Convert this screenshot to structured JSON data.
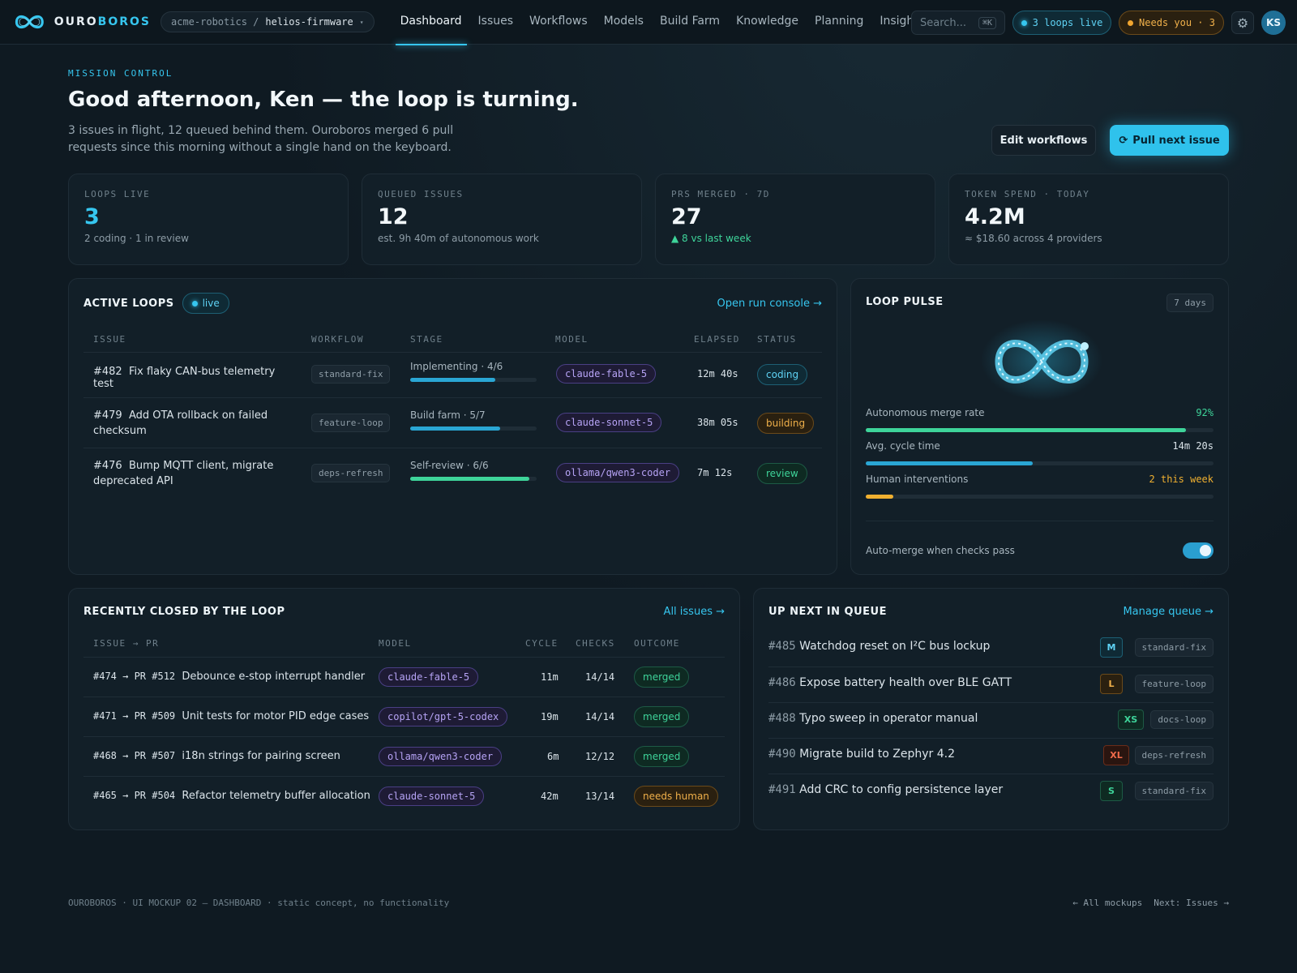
{
  "brand": {
    "name_a": "OURO",
    "name_b": "BOROS"
  },
  "repo": {
    "org": "acme-robotics /",
    "name": "helios-firmware",
    "caret": "▾"
  },
  "nav": [
    "Dashboard",
    "Issues",
    "Workflows",
    "Models",
    "Build Farm",
    "Knowledge",
    "Planning",
    "Insights"
  ],
  "search": {
    "placeholder": "Search...",
    "shortcut": "⌘K"
  },
  "pills": {
    "live": "3 loops live",
    "needs": "Needs you · 3"
  },
  "user": {
    "initials": "KS"
  },
  "header": {
    "eyebrow": "MISSION CONTROL",
    "title": "Good afternoon, Ken — the loop is turning.",
    "subtitle": "3 issues in flight, 12 queued behind them. Ouroboros merged 6 pull requests since this morning without a single hand on the keyboard.",
    "edit_label": "Edit workflows",
    "pull_label": "Pull next issue"
  },
  "stats": [
    {
      "label": "LOOPS LIVE",
      "value": "3",
      "sub": "2 coding · 1 in review"
    },
    {
      "label": "QUEUED ISSUES",
      "value": "12",
      "sub": "est. 9h 40m of autonomous work"
    },
    {
      "label": "PRS MERGED · 7D",
      "value": "27",
      "sub": "▲ 8 vs last week"
    },
    {
      "label": "TOKEN SPEND · TODAY",
      "value": "4.2M",
      "sub": "≈ $18.60 across 4 providers"
    }
  ],
  "active_loops": {
    "title": "ACTIVE LOOPS",
    "badge": "live",
    "link": "Open run console →",
    "columns": [
      "ISSUE",
      "WORKFLOW",
      "STAGE",
      "MODEL",
      "ELAPSED",
      "STATUS"
    ],
    "rows": [
      {
        "num": "#482",
        "title": "Fix flaky CAN-bus telemetry test",
        "workflow": "standard-fix",
        "stage": "Implementing · 4/6",
        "progress": 0.67,
        "model": "claude-fable-5",
        "elapsed": "12m 40s",
        "status": "coding"
      },
      {
        "num": "#479",
        "title": "Add OTA rollback on failed checksum",
        "workflow": "feature-loop",
        "stage": "Build farm · 5/7",
        "progress": 0.71,
        "model": "claude-sonnet-5",
        "elapsed": "38m 05s",
        "status": "building"
      },
      {
        "num": "#476",
        "title": "Bump MQTT client, migrate deprecated API",
        "workflow": "deps-refresh",
        "stage": "Self-review · 6/6",
        "progress": 0.94,
        "model": "ollama/qwen3-coder",
        "elapsed": "7m 12s",
        "status": "review"
      }
    ]
  },
  "pulse": {
    "title": "LOOP PULSE",
    "range": "7 days",
    "metrics": [
      {
        "label": "Autonomous merge rate",
        "value": "92%",
        "fill": 0.92,
        "color": "#3ed49a"
      },
      {
        "label": "Avg. cycle time",
        "value": "14m 20s",
        "fill": 0.48,
        "color": "#2aa6d4"
      },
      {
        "label": "Human interventions",
        "value": "2 this week",
        "fill": 0.08,
        "color": "#f0b030"
      }
    ],
    "toggle_label": "Auto-merge when checks pass",
    "toggle_on": true
  },
  "closed": {
    "title": "RECENTLY CLOSED BY THE LOOP",
    "link": "All issues →",
    "columns": [
      "ISSUE → PR",
      "MODEL",
      "CYCLE",
      "CHECKS",
      "OUTCOME"
    ],
    "rows": [
      {
        "ref": "#474 → PR #512",
        "title": "Debounce e-stop interrupt handler",
        "model": "claude-fable-5",
        "cycle": "11m",
        "checks": "14/14",
        "outcome": "merged"
      },
      {
        "ref": "#471 → PR #509",
        "title": "Unit tests for motor PID edge cases",
        "model": "copilot/gpt-5-codex",
        "cycle": "19m",
        "checks": "14/14",
        "outcome": "merged"
      },
      {
        "ref": "#468 → PR #507",
        "title": "i18n strings for pairing screen",
        "model": "ollama/qwen3-coder",
        "cycle": "6m",
        "checks": "12/12",
        "outcome": "merged"
      },
      {
        "ref": "#465 → PR #504",
        "title": "Refactor telemetry buffer allocation",
        "model": "claude-sonnet-5",
        "cycle": "42m",
        "checks": "13/14",
        "outcome": "needs human"
      }
    ]
  },
  "queue": {
    "title": "UP NEXT IN QUEUE",
    "link": "Manage queue →",
    "items": [
      {
        "num": "#485",
        "title": "Watchdog reset on I²C bus lockup",
        "size": "M",
        "workflow": "standard-fix"
      },
      {
        "num": "#486",
        "title": "Expose battery health over BLE GATT",
        "size": "L",
        "workflow": "feature-loop"
      },
      {
        "num": "#488",
        "title": "Typo sweep in operator manual",
        "size": "XS",
        "workflow": "docs-loop"
      },
      {
        "num": "#490",
        "title": "Migrate build to Zephyr 4.2",
        "size": "XL",
        "workflow": "deps-refresh"
      },
      {
        "num": "#491",
        "title": "Add CRC to config persistence layer",
        "size": "S",
        "workflow": "standard-fix"
      }
    ]
  },
  "footer": {
    "left": "OUROBOROS · UI MOCKUP 02 — DASHBOARD · static concept, no functionality",
    "back": "← All mockups",
    "next": "Next: Issues →"
  }
}
